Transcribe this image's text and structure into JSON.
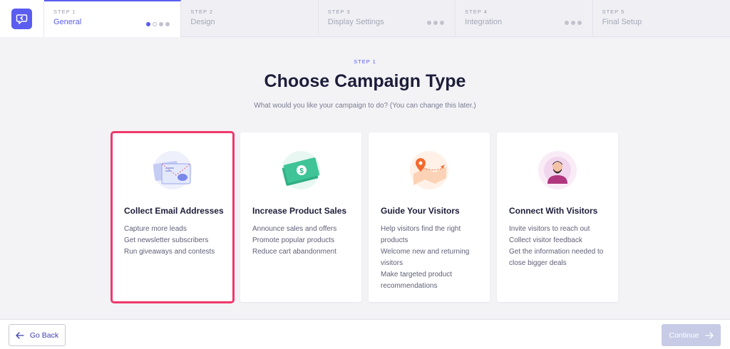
{
  "stepper": {
    "steps": [
      {
        "label": "STEP 1",
        "name": "General"
      },
      {
        "label": "STEP 2",
        "name": "Design"
      },
      {
        "label": "STEP 3",
        "name": "Display Settings"
      },
      {
        "label": "STEP 4",
        "name": "Integration"
      },
      {
        "label": "STEP 5",
        "name": "Final Setup"
      }
    ],
    "active_step": 1
  },
  "header": {
    "eyebrow": "STEP 1",
    "title": "Choose Campaign Type",
    "subtitle": "What would you like your campaign to do? (You can change this later.)"
  },
  "cards": [
    {
      "title": "Collect Email Addresses",
      "icon": "envelope-icon",
      "items": [
        "Capture more leads",
        "Get newsletter subscribers",
        "Run giveaways and contests"
      ],
      "selected": true
    },
    {
      "title": "Increase Product Sales",
      "icon": "money-bill-icon",
      "items": [
        "Announce sales and offers",
        "Promote popular products",
        "Reduce cart abandonment"
      ],
      "selected": false
    },
    {
      "title": "Guide Your Visitors",
      "icon": "map-pin-icon",
      "items": [
        "Help visitors find the right",
        "products",
        "Welcome new and returning",
        "visitors",
        "Make targeted product",
        "recommendations"
      ],
      "selected": false
    },
    {
      "title": "Connect With Visitors",
      "icon": "avatar-icon",
      "items": [
        "Invite visitors to reach out",
        "Collect visitor feedback",
        "Get the information needed to",
        "close bigger deals"
      ],
      "selected": false
    }
  ],
  "footer": {
    "back_label": "Go Back",
    "continue_label": "Continue"
  },
  "colors": {
    "accent": "#5a5df0",
    "selected_border": "#f0386b",
    "continue_disabled": "#c8cbe6"
  }
}
